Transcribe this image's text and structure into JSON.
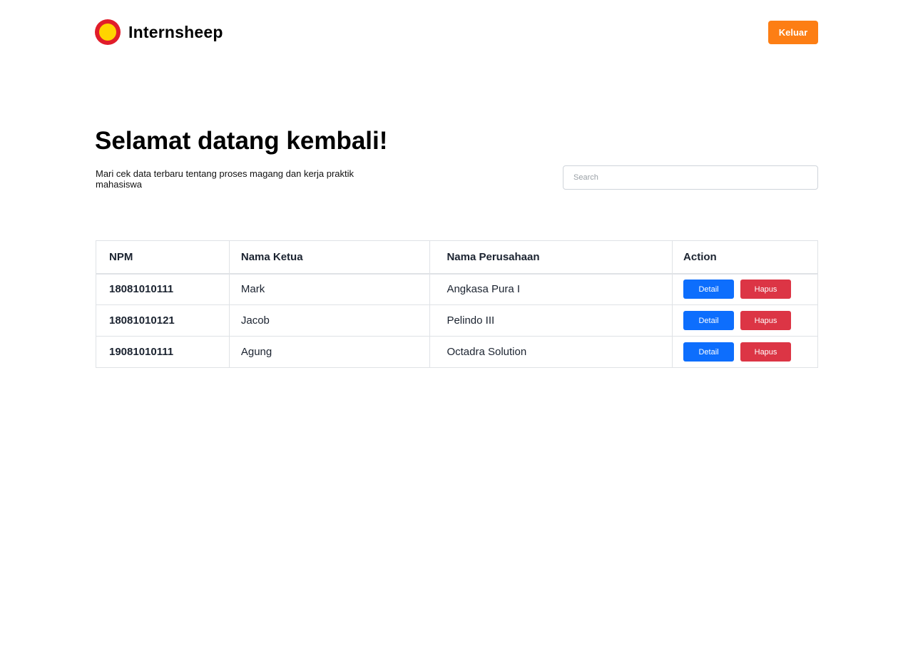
{
  "header": {
    "brand": "Internsheep",
    "logout_label": "Keluar"
  },
  "hero": {
    "title": "Selamat datang kembali!",
    "subtitle": "Mari cek data terbaru tentang proses magang dan kerja praktik mahasiswa"
  },
  "search": {
    "placeholder": "Search",
    "value": ""
  },
  "table": {
    "columns": [
      "NPM",
      "Nama Ketua",
      "Nama Perusahaan",
      "Action"
    ],
    "rows": [
      {
        "npm": "18081010111",
        "leader": "Mark",
        "company": "Angkasa Pura I"
      },
      {
        "npm": "18081010121",
        "leader": "Jacob",
        "company": "Pelindo III"
      },
      {
        "npm": "19081010111",
        "leader": "Agung",
        "company": "Octadra Solution"
      }
    ],
    "detail_label": "Detail",
    "delete_label": "Hapus"
  },
  "colors": {
    "accent_orange": "#fd7e14",
    "primary_blue": "#0d6efd",
    "danger_red": "#dc3545",
    "logo_outer": "#e11d2a",
    "logo_inner": "#ffd400"
  },
  "icons": {
    "logo": "sun-logo-icon"
  }
}
